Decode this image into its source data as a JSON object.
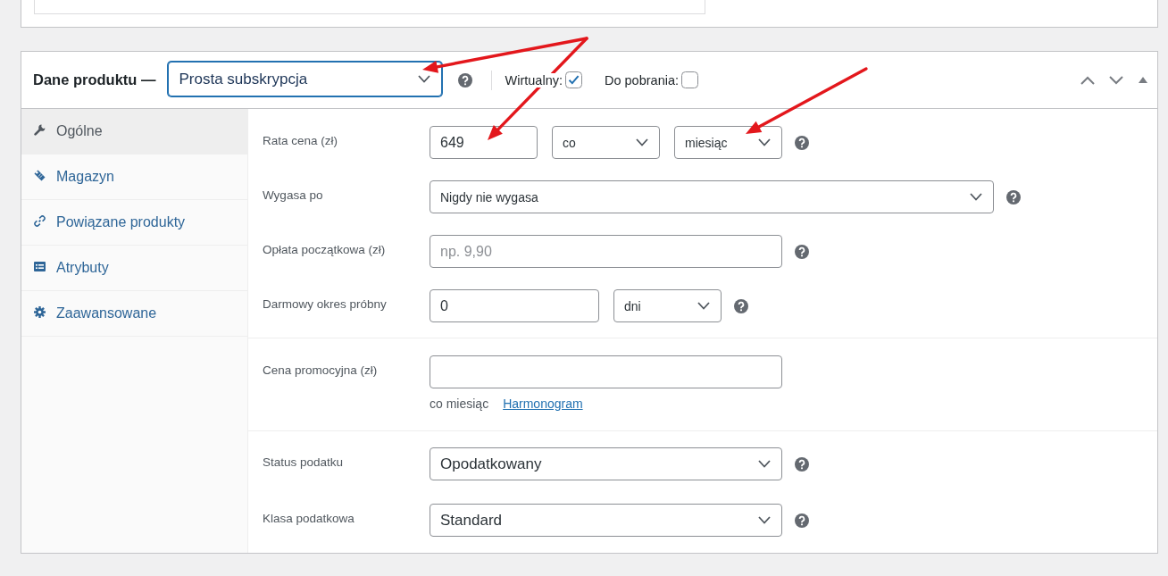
{
  "product_data": {
    "title": "Dane produktu —",
    "product_type": {
      "value": "Prosta subskrypcja",
      "focused": true
    },
    "checkboxes": [
      {
        "label": "Wirtualny:",
        "checked": true
      },
      {
        "label": "Do pobrania:",
        "checked": false
      }
    ],
    "handle_buttons": [
      {
        "kind": "up"
      },
      {
        "kind": "down"
      },
      {
        "kind": "toggle"
      }
    ]
  },
  "tabs": [
    {
      "label": "Ogólne",
      "kind": "general",
      "selected": true
    },
    {
      "label": "Magazyn",
      "kind": "inventory",
      "selected": false
    },
    {
      "label": "Powiązane produkty",
      "kind": "linked",
      "selected": false
    },
    {
      "label": "Atrybuty",
      "kind": "attributes",
      "selected": false
    },
    {
      "label": "Zaawansowane",
      "kind": "advanced",
      "selected": false
    }
  ],
  "sections": [
    {
      "fields": [
        {
          "label": "Rata cena (zł)",
          "controls": [
            {
              "kind": "input",
              "value": "649"
            },
            {
              "kind": "select",
              "value": "co"
            },
            {
              "kind": "select",
              "value": "miesiąc"
            }
          ],
          "help": true
        },
        {
          "label": "Wygasa po",
          "controls": [
            {
              "kind": "select",
              "value": "Nigdy nie wygasa"
            }
          ],
          "help": true
        },
        {
          "label": "Opłata początkowa (zł)",
          "controls": [
            {
              "kind": "input",
              "placeholder": "np. 9,90"
            }
          ],
          "help": true
        },
        {
          "label": "Darmowy okres próbny",
          "controls": [
            {
              "kind": "input",
              "value": "0"
            },
            {
              "kind": "select",
              "value": "dni"
            }
          ],
          "help": true
        }
      ]
    },
    {
      "fields": [
        {
          "label": "Cena promocyjna (zł)",
          "controls": [
            {
              "kind": "input"
            }
          ],
          "help": false,
          "note": "co miesiąc",
          "link": "Harmonogram"
        }
      ]
    },
    {
      "fields": [
        {
          "label": "Status podatku",
          "controls": [
            {
              "kind": "select",
              "value": "Opodatkowany"
            }
          ],
          "help": true
        },
        {
          "label": "Klasa podatkowa",
          "controls": [
            {
              "kind": "select",
              "value": "Standard"
            }
          ],
          "help": true
        }
      ]
    }
  ],
  "annotations": [
    {
      "kind": "arrow"
    },
    {
      "kind": "arrow"
    },
    {
      "kind": "arrow"
    }
  ]
}
